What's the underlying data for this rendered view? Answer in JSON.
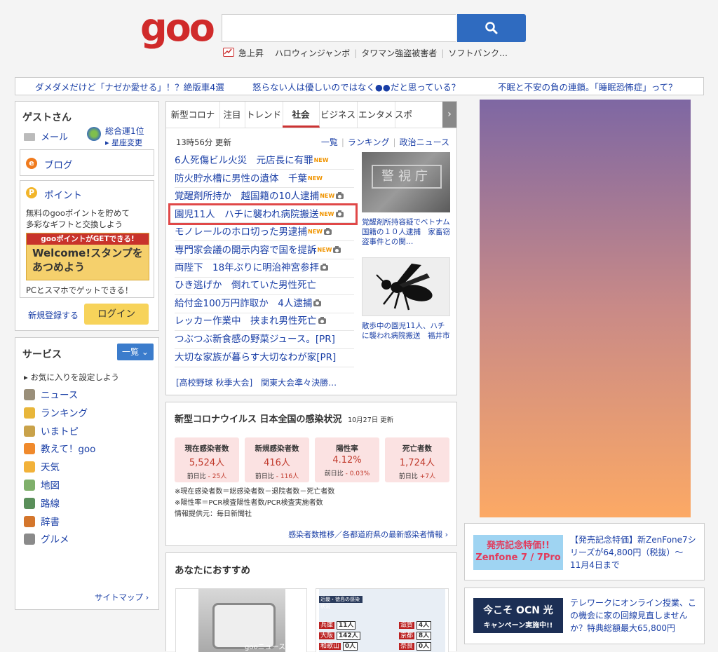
{
  "header": {
    "logo_text": "goo",
    "search_placeholder": "",
    "trends": {
      "label": "急上昇",
      "items": [
        "ハロウィンジャンボ",
        "タワマン強盗被害者",
        "ソフトバンク…"
      ]
    }
  },
  "banner": {
    "links": [
      "ダメダメだけど「ナゼか愛せる」！？絶版車4選",
      "怒らない人は優しいのではなく●●だと思っている？",
      "不眠と不安の負の連鎖。「睡眠恐怖症」って？"
    ]
  },
  "user": {
    "greeting_name": "ゲスト",
    "greeting_suffix": "さん",
    "mail_label": "メール",
    "fortune_label": "総合運1位",
    "zodiac_change": "星座変更",
    "blog_label": "ブログ",
    "point_label": "ポイント",
    "point_desc_1": "無料のgooポイントを貯めて",
    "point_desc_2": "多彩なギフトと交換しよう",
    "promo_top": "gooポイントがGETできる!",
    "promo_main_1": "Welcome!スタンプを",
    "promo_main_2": "あつめよう",
    "promo_sub": "PCとスマホでゲットできる！",
    "register_label": "新規登録する",
    "login_label": "ログイン"
  },
  "services": {
    "title": "サービス",
    "list_button": "一覧",
    "favorite_label": "お気に入りを設定しよう",
    "items": [
      {
        "label": "ニュース",
        "color": "#9a8f7a"
      },
      {
        "label": "ランキング",
        "color": "#e8b63a"
      },
      {
        "label": "いまトピ",
        "color": "#c9a24a"
      },
      {
        "label": "教えて！goo",
        "color": "#f08a2c"
      },
      {
        "label": "天気",
        "color": "#f2b23a"
      },
      {
        "label": "地図",
        "color": "#7fb06b"
      },
      {
        "label": "路線",
        "color": "#5a8f5a"
      },
      {
        "label": "辞書",
        "color": "#d4762c"
      },
      {
        "label": "グルメ",
        "color": "#8a8a8a"
      }
    ],
    "sitemap_label": "サイトマップ"
  },
  "news": {
    "tabs": [
      "新型コロナ",
      "注目",
      "トレンド",
      "社会",
      "ビジネス",
      "エンタメ",
      "スポー"
    ],
    "active_tab": "社会",
    "updated": "13時56分 更新",
    "links": [
      "一覧",
      "ランキング",
      "政治ニュース"
    ],
    "headlines": [
      {
        "text": "6人死傷ビル火災　元店長に有罪",
        "new": true,
        "photo": false,
        "highlight": false
      },
      {
        "text": "防火貯水槽に男性の遺体　千葉",
        "new": true,
        "photo": false,
        "highlight": false
      },
      {
        "text": "覚醒剤所持か　越国籍の10人逮捕",
        "new": true,
        "photo": true,
        "highlight": false
      },
      {
        "text": "園児11人　ハチに襲われ病院搬送",
        "new": true,
        "photo": true,
        "highlight": true
      },
      {
        "text": "モノレールのホロ切った男逮捕",
        "new": true,
        "photo": true,
        "highlight": false
      },
      {
        "text": "専門家会議の開示内容で国を提訴",
        "new": true,
        "photo": true,
        "highlight": false
      },
      {
        "text": "両陛下　18年ぶりに明治神宮参拝",
        "new": false,
        "photo": true,
        "highlight": false
      },
      {
        "text": "ひき逃げか　倒れていた男性死亡",
        "new": false,
        "photo": false,
        "highlight": false
      },
      {
        "text": "給付金100万円詐取か　4人逮捕",
        "new": false,
        "photo": true,
        "highlight": false
      },
      {
        "text": "レッカー作業中　挟まれ男性死亡",
        "new": false,
        "photo": true,
        "highlight": false
      },
      {
        "text": "つぶつぶ新食感の野菜ジュース。[PR]",
        "new": false,
        "photo": false,
        "highlight": false
      },
      {
        "text": "大切な家族が暮らす大切なわが家[PR]",
        "new": false,
        "photo": false,
        "highlight": false
      }
    ],
    "new_badge": "NEW",
    "footer_link": "[高校野球 秋季大会]　関東大会準々決勝…",
    "photo1_sign": "警視庁",
    "photo1_caption": "覚醒剤所持容疑でベトナム国籍の１０人逮捕　家畜窃盗事件との関…",
    "photo2_caption": "散歩中の園児11人、ハチに襲われ病院搬送　福井市"
  },
  "covid": {
    "title": "新型コロナウイルス 日本全国の感染状況",
    "date": "10月27日 更新",
    "cards": [
      {
        "label": "現在感染者数",
        "value": "5,524人",
        "diff_label": "前日比",
        "diff": "- 25人"
      },
      {
        "label": "新規感染者数",
        "value": "416人",
        "diff_label": "前日比",
        "diff": "- 116人"
      },
      {
        "label": "陽性率",
        "value": "4.12%",
        "diff_label": "前日比",
        "diff": "- 0.03%"
      },
      {
        "label": "死亡者数",
        "value": "1,724人",
        "diff_label": "前日比",
        "diff": "+7人"
      }
    ],
    "note1": "※現在感染者数＝総感染者数－退院者数－死亡者数",
    "note2": "※陽性率＝PCR検査陽性者数/PCR検査実施者数",
    "source": "情報提供元：毎日新聞社",
    "more_link": "感染者数推移／各都道府県の最新感染者情報"
  },
  "recommend": {
    "title": "あなたにおすすめ",
    "thumb1_text": "gooニュース",
    "thumb2_header": "近畿・徳島の感染状況",
    "thumb2_rows": [
      {
        "pref": "兵庫",
        "val": "11人"
      },
      {
        "pref": "大阪",
        "val": "142人"
      },
      {
        "pref": "和歌山",
        "val": "0人"
      },
      {
        "pref": "滋賀",
        "val": "4人"
      },
      {
        "pref": "京都",
        "val": "8人"
      },
      {
        "pref": "奈良",
        "val": "0人"
      }
    ]
  },
  "ads": {
    "ad1_img_1": "発売記念特価!!",
    "ad1_img_2": "Zenfone 7 / 7Pro",
    "ad1_text": "【発売記念特価】新ZenFone7シリーズが64,800円（税抜）～　11月4日まで",
    "ad2_img_1": "今こそ OCN 光",
    "ad2_img_2": "キャンペーン実施中!!",
    "ad2_text": "テレワークにオンライン授業、この機会に家の回線見直しませんか？特典総額最大65,800円"
  },
  "colors": {
    "brand_red": "#d02a2a",
    "search_blue": "#2f6bc0",
    "link_blue": "#1a3fa6",
    "login_yellow": "#f7d35a",
    "highlight_red": "#e04848"
  }
}
